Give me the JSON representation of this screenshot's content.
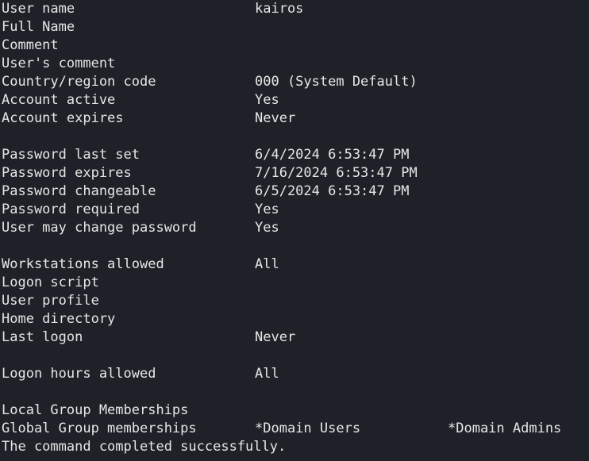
{
  "colors": {
    "background": "#1f2128",
    "text": "#e6e6e6"
  },
  "fields": [
    {
      "label": "User name",
      "value": "kairos"
    },
    {
      "label": "Full Name",
      "value": ""
    },
    {
      "label": "Comment",
      "value": ""
    },
    {
      "label": "User's comment",
      "value": ""
    },
    {
      "label": "Country/region code",
      "value": "000 (System Default)"
    },
    {
      "label": "Account active",
      "value": "Yes"
    },
    {
      "label": "Account expires",
      "value": "Never"
    },
    {
      "label": "Password last set",
      "value": "6/4/2024 6:53:47 PM"
    },
    {
      "label": "Password expires",
      "value": "7/16/2024 6:53:47 PM"
    },
    {
      "label": "Password changeable",
      "value": "6/5/2024 6:53:47 PM"
    },
    {
      "label": "Password required",
      "value": "Yes"
    },
    {
      "label": "User may change password",
      "value": "Yes"
    },
    {
      "label": "Workstations allowed",
      "value": "All"
    },
    {
      "label": "Logon script",
      "value": ""
    },
    {
      "label": "User profile",
      "value": ""
    },
    {
      "label": "Home directory",
      "value": ""
    },
    {
      "label": "Last logon",
      "value": "Never"
    },
    {
      "label": "Logon hours allowed",
      "value": "All"
    },
    {
      "label": "Local Group Memberships",
      "value": ""
    },
    {
      "label": "Global Group memberships",
      "value": "*Domain Users",
      "value2": "*Domain Admins"
    }
  ],
  "status": "The command completed successfully."
}
